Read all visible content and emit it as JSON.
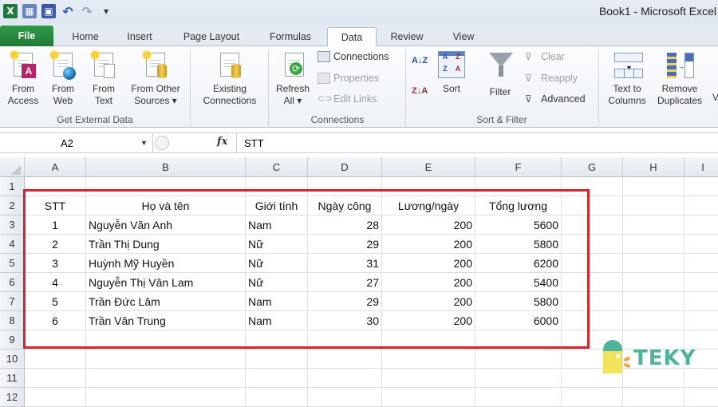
{
  "window": {
    "title": "Book1  -  Microsoft Excel"
  },
  "quick_access": [
    {
      "name": "excel-logo-icon",
      "glyph": "X"
    },
    {
      "name": "form-icon",
      "glyph": "▦"
    },
    {
      "name": "save-icon",
      "glyph": "▣"
    },
    {
      "name": "undo-icon",
      "glyph": "↶"
    },
    {
      "name": "redo-icon",
      "glyph": "↷"
    },
    {
      "name": "customize-icon",
      "glyph": "▾"
    }
  ],
  "tabs": [
    {
      "label": "File"
    },
    {
      "label": "Home"
    },
    {
      "label": "Insert"
    },
    {
      "label": "Page Layout"
    },
    {
      "label": "Formulas"
    },
    {
      "label": "Data",
      "active": true
    },
    {
      "label": "Review"
    },
    {
      "label": "View"
    }
  ],
  "ribbon": {
    "get_external_data": {
      "label": "Get External Data",
      "buttons": [
        {
          "line1": "From",
          "line2": "Access"
        },
        {
          "line1": "From",
          "line2": "Web"
        },
        {
          "line1": "From",
          "line2": "Text"
        },
        {
          "line1": "From Other",
          "line2": "Sources ▾"
        }
      ]
    },
    "existing_connections": {
      "line1": "Existing",
      "line2": "Connections"
    },
    "connections": {
      "label": "Connections",
      "refresh": {
        "line1": "Refresh",
        "line2": "All ▾"
      },
      "connections_btn": "Connections",
      "properties_btn": "Properties",
      "edit_links_btn": "Edit Links"
    },
    "sort_filter": {
      "label": "Sort & Filter",
      "sort_az": "A↓Z",
      "sort_za": "Z↓A",
      "sort": "Sort",
      "filter": "Filter",
      "clear": "Clear",
      "reapply": "Reapply",
      "advanced": "Advanced"
    },
    "data_tools": {
      "text_to_columns": {
        "line1": "Text to",
        "line2": "Columns"
      },
      "remove_duplicates": {
        "line1": "Remove",
        "line2": "Duplicates"
      },
      "cut_off": "V"
    }
  },
  "formula_bar": {
    "name_box": "A2",
    "fx": "fx",
    "formula": "STT"
  },
  "sheet": {
    "columns": [
      "A",
      "B",
      "C",
      "D",
      "E",
      "F",
      "G",
      "H",
      "I"
    ],
    "rows": [
      "1",
      "2",
      "3",
      "4",
      "5",
      "6",
      "7",
      "8",
      "9",
      "10",
      "11",
      "12"
    ],
    "headers": [
      "STT",
      "Họ và tên",
      "Giới tính",
      "Ngày công",
      "Lương/ngày",
      "Tổng lương"
    ],
    "records": [
      [
        "1",
        "Nguyễn Văn Anh",
        "Nam",
        "28",
        "200",
        "5600"
      ],
      [
        "2",
        "Trần Thị Dung",
        "Nữ",
        "29",
        "200",
        "5800"
      ],
      [
        "3",
        "Huỳnh Mỹ Huyền",
        "Nữ",
        "31",
        "200",
        "6200"
      ],
      [
        "4",
        "Nguyễn Thị Vân Lam",
        "Nữ",
        "27",
        "200",
        "5400"
      ],
      [
        "5",
        "Trần Đức Lâm",
        "Nam",
        "29",
        "200",
        "5800"
      ],
      [
        "6",
        "Trần Văn Trung",
        "Nam",
        "30",
        "200",
        "6000"
      ]
    ]
  },
  "watermark": {
    "text": "TEKY"
  },
  "colors": {
    "highlight": "#d8232a",
    "file_tab": "#1f7a36",
    "logo_teal": "#4db39a",
    "logo_yellow": "#f3e35a"
  }
}
